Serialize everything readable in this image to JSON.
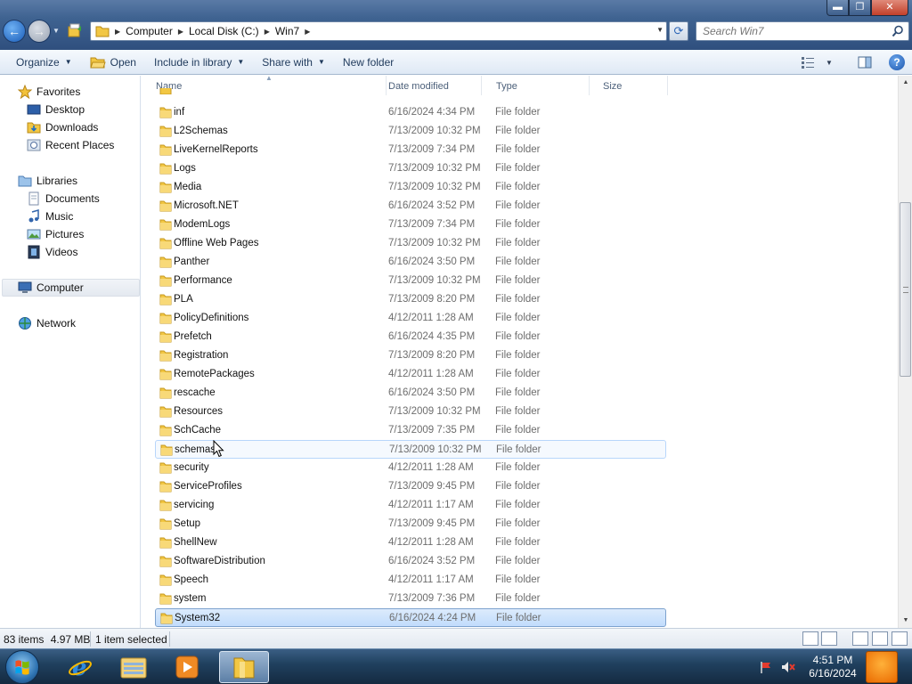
{
  "window": {
    "controls": {
      "minimize": "▬",
      "maximize": "❐",
      "close": "✕"
    }
  },
  "nav": {
    "back_glyph": "←",
    "forward_glyph": "→",
    "recent_glyph": "▼",
    "address": {
      "breadcrumbs": [
        "Computer",
        "Local Disk (C:)",
        "Win7"
      ],
      "separator": "▶",
      "dropdown_glyph": "▼"
    },
    "refresh_glyph": "⟳",
    "search": {
      "placeholder": "Search Win7",
      "icon": "search-icon"
    }
  },
  "toolbar": {
    "organize": "Organize",
    "open": "Open",
    "include_in_library": "Include in library",
    "share_with": "Share with",
    "new_folder": "New folder",
    "dropdown_glyph": "▼",
    "help_glyph": "?"
  },
  "navpane": {
    "favorites": "Favorites",
    "desktop": "Desktop",
    "downloads": "Downloads",
    "recent_places": "Recent Places",
    "libraries": "Libraries",
    "documents": "Documents",
    "music": "Music",
    "pictures": "Pictures",
    "videos": "Videos",
    "computer": "Computer",
    "network": "Network"
  },
  "columns": {
    "name": "Name",
    "date_modified": "Date modified",
    "type": "Type",
    "size": "Size",
    "sort_glyph": "▲"
  },
  "files": [
    {
      "name": "inf",
      "date": "6/16/2024 4:34 PM",
      "type": "File folder"
    },
    {
      "name": "L2Schemas",
      "date": "7/13/2009 10:32 PM",
      "type": "File folder"
    },
    {
      "name": "LiveKernelReports",
      "date": "7/13/2009 7:34 PM",
      "type": "File folder"
    },
    {
      "name": "Logs",
      "date": "7/13/2009 10:32 PM",
      "type": "File folder"
    },
    {
      "name": "Media",
      "date": "7/13/2009 10:32 PM",
      "type": "File folder"
    },
    {
      "name": "Microsoft.NET",
      "date": "6/16/2024 3:52 PM",
      "type": "File folder"
    },
    {
      "name": "ModemLogs",
      "date": "7/13/2009 7:34 PM",
      "type": "File folder"
    },
    {
      "name": "Offline Web Pages",
      "date": "7/13/2009 10:32 PM",
      "type": "File folder"
    },
    {
      "name": "Panther",
      "date": "6/16/2024 3:50 PM",
      "type": "File folder"
    },
    {
      "name": "Performance",
      "date": "7/13/2009 10:32 PM",
      "type": "File folder"
    },
    {
      "name": "PLA",
      "date": "7/13/2009 8:20 PM",
      "type": "File folder"
    },
    {
      "name": "PolicyDefinitions",
      "date": "4/12/2011 1:28 AM",
      "type": "File folder"
    },
    {
      "name": "Prefetch",
      "date": "6/16/2024 4:35 PM",
      "type": "File folder"
    },
    {
      "name": "Registration",
      "date": "7/13/2009 8:20 PM",
      "type": "File folder"
    },
    {
      "name": "RemotePackages",
      "date": "4/12/2011 1:28 AM",
      "type": "File folder"
    },
    {
      "name": "rescache",
      "date": "6/16/2024 3:50 PM",
      "type": "File folder"
    },
    {
      "name": "Resources",
      "date": "7/13/2009 10:32 PM",
      "type": "File folder"
    },
    {
      "name": "SchCache",
      "date": "7/13/2009 7:35 PM",
      "type": "File folder"
    },
    {
      "name": "schemas",
      "date": "7/13/2009 10:32 PM",
      "type": "File folder",
      "state": "hover"
    },
    {
      "name": "security",
      "date": "4/12/2011 1:28 AM",
      "type": "File folder"
    },
    {
      "name": "ServiceProfiles",
      "date": "7/13/2009 9:45 PM",
      "type": "File folder"
    },
    {
      "name": "servicing",
      "date": "4/12/2011 1:17 AM",
      "type": "File folder"
    },
    {
      "name": "Setup",
      "date": "7/13/2009 9:45 PM",
      "type": "File folder"
    },
    {
      "name": "ShellNew",
      "date": "4/12/2011 1:28 AM",
      "type": "File folder"
    },
    {
      "name": "SoftwareDistribution",
      "date": "6/16/2024 3:52 PM",
      "type": "File folder"
    },
    {
      "name": "Speech",
      "date": "4/12/2011 1:17 AM",
      "type": "File folder"
    },
    {
      "name": "system",
      "date": "7/13/2009 7:36 PM",
      "type": "File folder"
    },
    {
      "name": "System32",
      "date": "6/16/2024 4:24 PM",
      "type": "File folder",
      "state": "selected"
    }
  ],
  "status": {
    "items": "83 items",
    "size": "4.97 MB",
    "selected": "1 item selected"
  },
  "taskbar": {
    "apps": [
      "internet-explorer",
      "windows-explorer",
      "media-player",
      "explorer-window-active"
    ],
    "clock_time": "4:51 PM",
    "clock_date": "6/16/2024"
  },
  "colors": {
    "selection": "#c1dcfc",
    "selection_border": "#7da2ce",
    "hover_border": "#b8d6fb",
    "folder_yellow": "#f2c744",
    "meta_text": "#6d6d6d"
  }
}
